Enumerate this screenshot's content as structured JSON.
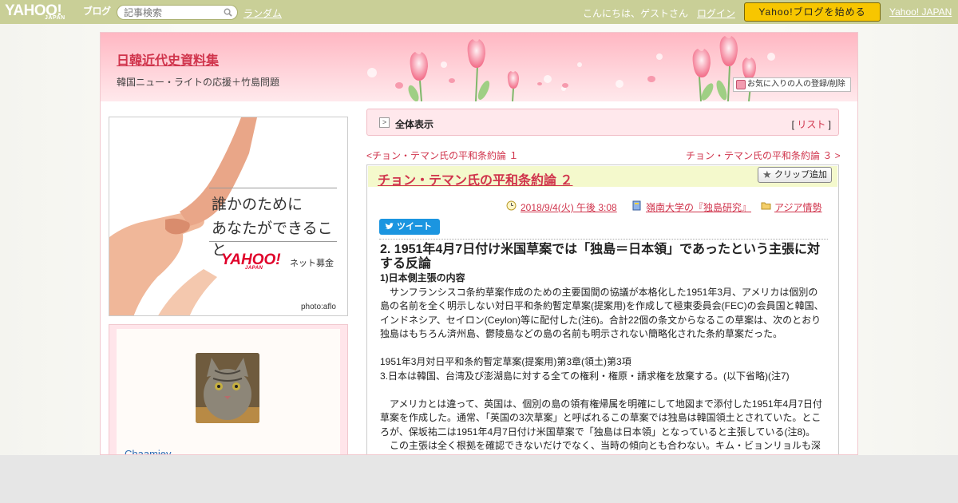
{
  "topbar": {
    "logo_text": "YAHOO!",
    "logo_sub": "JAPAN",
    "logo_blog": "ブログ",
    "search_placeholder": "記事検索",
    "random_link": "ランダム",
    "greeting": "こんにちは、ゲストさん",
    "login_link": "ログイン",
    "start_button": "Yahoo!ブログを始める",
    "yahoo_japan_link": "Yahoo! JAPAN"
  },
  "header": {
    "title": "日韓近代史資料集",
    "description": "韓国ニュー・ライトの応援＋竹島問題",
    "fav_button": "お気に入りの人の登録/削除"
  },
  "ad": {
    "line1": "誰かのために",
    "line2": "あなたができること",
    "logo": "YAHOO!",
    "logo_sub": "JAPAN",
    "logo_text": "ネット募金",
    "photo_credit": "photo:aflo"
  },
  "profile": {
    "username": "Chaamiey"
  },
  "main": {
    "show_all": "全体表示",
    "list_link": "リスト",
    "prev_link": "<チョン・テマン氏の平和条約論 １",
    "next_link": "チョン・テマン氏の平和条約論 ３ >"
  },
  "article": {
    "title": "チョン・テマン氏の平和条約論 ２",
    "clip_button": "クリップ追加",
    "date": "2018/9/4(火) 午後 3:08",
    "category1": "嶺南大学の『独島研究』",
    "category2": "アジア情勢",
    "tweet": "ツイート",
    "heading": "2. 1951年4月7日付け米国草案では「独島＝日本領」であったという主張に対する反論",
    "subheading": "1)日本側主張の内容",
    "para1": "　サンフランシスコ条約草案作成のための主要国間の協議が本格化した1951年3月、アメリカは個別の島の名前を全く明示しない対日平和条約暫定草案(提案用)を作成して極東委員会(FEC)の会員国と韓国、インドネシア、セイロン(Ceylon)等に配付した(注6)。合計22個の条文からなるこの草案は、次のとおり独島はもちろん済州島、鬱陵島などの島の名前も明示されない簡略化された条約草案だった。",
    "quote1": "1951年3月対日平和条約暫定草案(提案用)第3章(領土)第3項",
    "quote2": "3.日本は韓国、台湾及び澎湖島に対する全ての権利・権原・請求権を放棄する。(以下省略)(注7)",
    "para2": "　アメリカとは違って、英国は、個別の島の領有権帰属を明確にして地図まで添付した1951年4月7日付草案を作成した。通常、「英国の3次草案」と呼ばれるこの草案では独島は韓国領土とされていた。ところが、保坂祐二は1951年4月7日付け米国草案で「独島は日本領」となっていると主張している(注8)。",
    "para3": "　この主張は全く根拠を確認できないだけでなく、当時の傾向とも合わない。キム・ビョンリョルも深"
  },
  "colors": {
    "topbar": "#c9cf97",
    "accent": "#d0344c",
    "start_button": "#f7c600",
    "tweet": "#1b95e0"
  },
  "icons": [
    "search-icon",
    "heart-icon",
    "arrow-icon",
    "star-icon",
    "clock-icon",
    "book-icon",
    "folder-icon",
    "bird-icon"
  ]
}
